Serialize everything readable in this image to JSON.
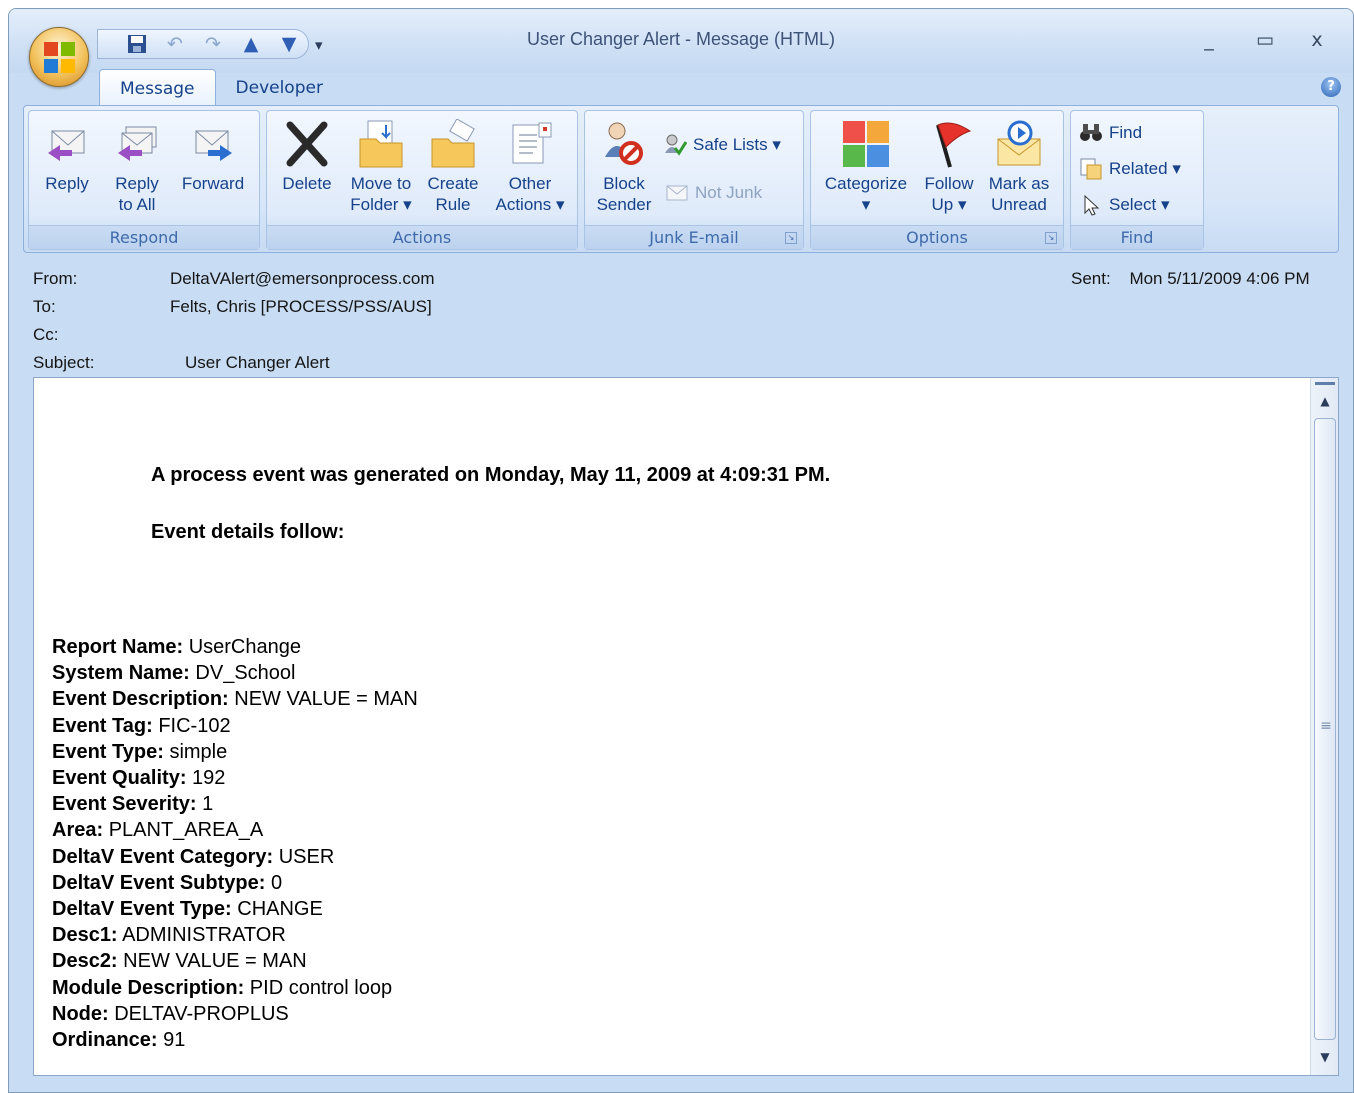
{
  "window": {
    "title": "User Changer Alert - Message (HTML)",
    "controls": {
      "minimize": "_",
      "maximize": "▭",
      "close": "x"
    }
  },
  "quick_access": {
    "save": "save-icon",
    "undo": "undo-icon",
    "redo": "redo-icon",
    "previous": "up-arrow-icon",
    "next": "down-arrow-icon",
    "customize": "▾"
  },
  "tabs": [
    {
      "label": "Message",
      "active": true
    },
    {
      "label": "Developer",
      "active": false
    }
  ],
  "ribbon": {
    "respond": {
      "label": "Respond",
      "reply": "Reply",
      "reply_all": "Reply\nto All",
      "forward": "Forward"
    },
    "actions": {
      "label": "Actions",
      "delete": "Delete",
      "move_to_folder": "Move to\nFolder ▾",
      "create_rule": "Create\nRule",
      "other_actions": "Other\nActions ▾"
    },
    "junk": {
      "label": "Junk E-mail",
      "block_sender": "Block\nSender",
      "safe_lists": "Safe Lists ▾",
      "not_junk": "Not Junk"
    },
    "options": {
      "label": "Options",
      "categorize": "Categorize\n▾",
      "follow_up": "Follow\nUp ▾",
      "mark_unread": "Mark as\nUnread"
    },
    "find": {
      "label": "Find",
      "find": "Find",
      "related": "Related ▾",
      "select": "Select ▾"
    }
  },
  "header": {
    "from_label": "From:",
    "from_value": "DeltaVAlert@emersonprocess.com",
    "to_label": "To:",
    "to_value": "Felts, Chris [PROCESS/PSS/AUS]",
    "cc_label": "Cc:",
    "cc_value": "",
    "subject_label": "Subject:",
    "subject_value": "User Changer Alert",
    "sent_label": "Sent:",
    "sent_value": "Mon 5/11/2009 4:06 PM"
  },
  "body": {
    "intro": "A process event was generated on Monday, May 11, 2009 at 4:09:31 PM.",
    "details_heading": "Event details follow:",
    "details": [
      {
        "label": "Report Name:",
        "value": "UserChange"
      },
      {
        "label": "System Name:",
        "value": "DV_School"
      },
      {
        "label": "Event Description:",
        "value": "NEW VALUE = MAN"
      },
      {
        "label": "Event Tag:",
        "value": "FIC-102"
      },
      {
        "label": "Event Type:",
        "value": "simple"
      },
      {
        "label": "Event Quality:",
        "value": "192"
      },
      {
        "label": "Event Severity:",
        "value": "1"
      },
      {
        "label": "Area:",
        "value": "PLANT_AREA_A"
      },
      {
        "label": "DeltaV Event Category:",
        "value": "USER"
      },
      {
        "label": "DeltaV Event Subtype:",
        "value": "0"
      },
      {
        "label": "DeltaV Event Type:",
        "value": "CHANGE"
      },
      {
        "label": "Desc1:",
        "value": "ADMINISTRATOR"
      },
      {
        "label": "Desc2:",
        "value": "NEW VALUE = MAN"
      },
      {
        "label": "Module Description:",
        "value": "PID control loop"
      },
      {
        "label": "Node:",
        "value": "DELTAV-PROPLUS"
      },
      {
        "label": "Ordinance:",
        "value": "91"
      }
    ]
  }
}
